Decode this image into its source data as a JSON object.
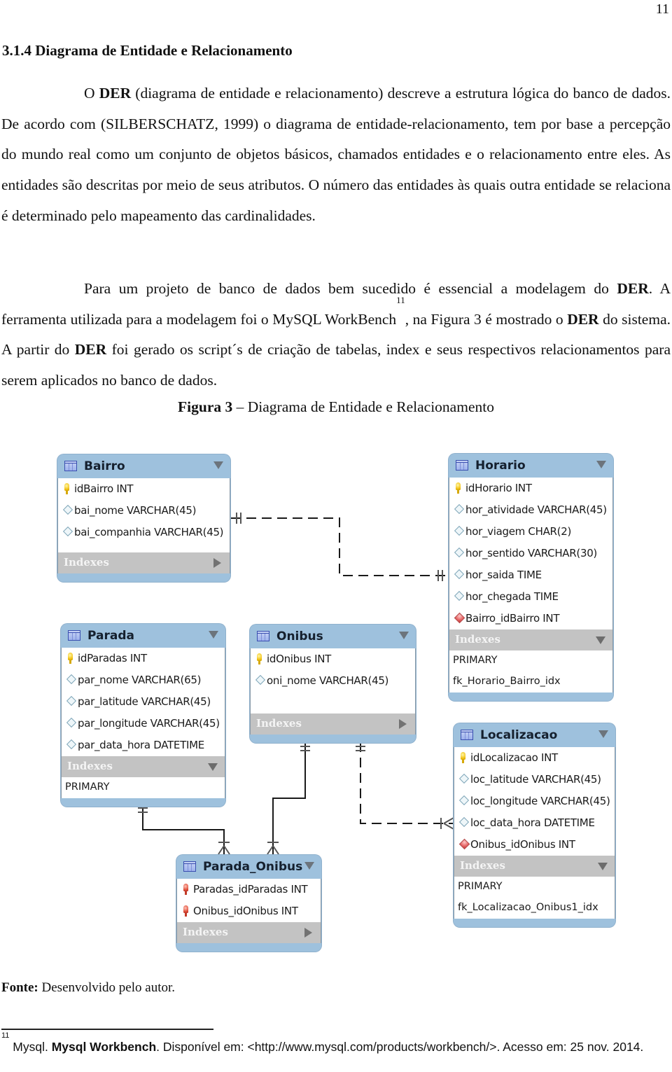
{
  "page_number": "11",
  "section_heading": "3.1.4 Diagrama de Entidade e Relacionamento",
  "paragraph1": {
    "part1": "O ",
    "bold1": "DER",
    "part2": " (diagrama de entidade e relacionamento) descreve a estrutura lógica do banco de dados. De acordo com (SILBERSCHATZ, 1999) o diagrama de entidade-relacionamento, tem por base a percepção do mundo real como um conjunto de objetos básicos, chamados entidades e o relacionamento entre eles. As entidades são descritas por meio de seus atributos. O número das entidades às quais outra entidade se relaciona é determinado pelo mapeamento das cardinalidades."
  },
  "paragraph2": {
    "part1": "Para um projeto de banco de dados bem sucedido é essencial a modelagem do ",
    "bold1": "DER",
    "part2": ". A ferramenta utilizada para a modelagem foi o MySQL WorkBench",
    "footnote_ref": "11",
    "part3": ", na Figura 3 é mostrado o ",
    "bold2": "DER",
    "part4": " do sistema.  A partir do ",
    "bold3": "DER",
    "part5": " foi gerado os script´s de criação de tabelas, index e seus respectivos relacionamentos para serem aplicados no banco de dados."
  },
  "figure_caption": {
    "label": "Figura 3",
    "text": " – Diagrama de Entidade e Relacionamento"
  },
  "diagram": {
    "indexes_label": "Indexes",
    "tables": {
      "bairro": {
        "name": "Bairro",
        "columns": [
          {
            "text": "idBairro INT",
            "icon": "primary-key"
          },
          {
            "text": "bai_nome VARCHAR(45)",
            "icon": "column"
          },
          {
            "text": "bai_companhia VARCHAR(45)",
            "icon": "column"
          }
        ],
        "indexes_expanded": false,
        "indexes": []
      },
      "horario": {
        "name": "Horario",
        "columns": [
          {
            "text": "idHorario INT",
            "icon": "primary-key"
          },
          {
            "text": "hor_atividade VARCHAR(45)",
            "icon": "column"
          },
          {
            "text": "hor_viagem CHAR(2)",
            "icon": "column"
          },
          {
            "text": "hor_sentido VARCHAR(30)",
            "icon": "column"
          },
          {
            "text": "hor_saida TIME",
            "icon": "column"
          },
          {
            "text": "hor_chegada TIME",
            "icon": "column"
          },
          {
            "text": "Bairro_idBairro INT",
            "icon": "foreign-key"
          }
        ],
        "indexes_expanded": true,
        "indexes": [
          "PRIMARY",
          "fk_Horario_Bairro_idx"
        ]
      },
      "parada": {
        "name": "Parada",
        "columns": [
          {
            "text": "idParadas INT",
            "icon": "primary-key"
          },
          {
            "text": "par_nome VARCHAR(65)",
            "icon": "column"
          },
          {
            "text": "par_latitude VARCHAR(45)",
            "icon": "column"
          },
          {
            "text": "par_longitude VARCHAR(45)",
            "icon": "column"
          },
          {
            "text": "par_data_hora DATETIME",
            "icon": "column"
          }
        ],
        "indexes_expanded": true,
        "indexes": [
          "PRIMARY"
        ]
      },
      "onibus": {
        "name": "Onibus",
        "columns": [
          {
            "text": "idOnibus INT",
            "icon": "primary-key"
          },
          {
            "text": "oni_nome VARCHAR(45)",
            "icon": "column"
          }
        ],
        "indexes_expanded": false,
        "indexes": []
      },
      "localizacao": {
        "name": "Localizacao",
        "columns": [
          {
            "text": "idLocalizacao INT",
            "icon": "primary-key"
          },
          {
            "text": "loc_latitude VARCHAR(45)",
            "icon": "column"
          },
          {
            "text": "loc_longitude VARCHAR(45)",
            "icon": "column"
          },
          {
            "text": "loc_data_hora DATETIME",
            "icon": "column"
          },
          {
            "text": "Onibus_idOnibus INT",
            "icon": "foreign-key"
          }
        ],
        "indexes_expanded": true,
        "indexes": [
          "PRIMARY",
          "fk_Localizacao_Onibus1_idx"
        ]
      },
      "parada_onibus": {
        "name": "Parada_Onibus",
        "columns": [
          {
            "text": "Paradas_idParadas INT",
            "icon": "primary-foreign-key"
          },
          {
            "text": "Onibus_idOnibus INT",
            "icon": "primary-foreign-key"
          }
        ],
        "indexes_expanded": false,
        "indexes": []
      }
    },
    "relationships": [
      {
        "from": "Bairro",
        "to": "Horario",
        "cardinality": "one-to-one-or-many",
        "identifying": false
      },
      {
        "from": "Parada",
        "to": "Parada_Onibus",
        "cardinality": "one-to-many",
        "identifying": true
      },
      {
        "from": "Onibus",
        "to": "Parada_Onibus",
        "cardinality": "one-to-many",
        "identifying": true
      },
      {
        "from": "Onibus",
        "to": "Localizacao",
        "cardinality": "one-to-many",
        "identifying": false
      }
    ],
    "colors": {
      "header": "#9ec1dd",
      "indexes_bar": "#c3c3c3",
      "line": "#1a1a1a"
    }
  },
  "source": {
    "label": "Fonte:",
    "text": " Desenvolvido pelo autor."
  },
  "footnote": {
    "number": "11",
    "part1": " Mysql. ",
    "bold": "Mysql Workbench",
    "part2": ". Disponível em: <http://www.mysql.com/products/workbench/>. Acesso em: 25 nov. 2014."
  }
}
